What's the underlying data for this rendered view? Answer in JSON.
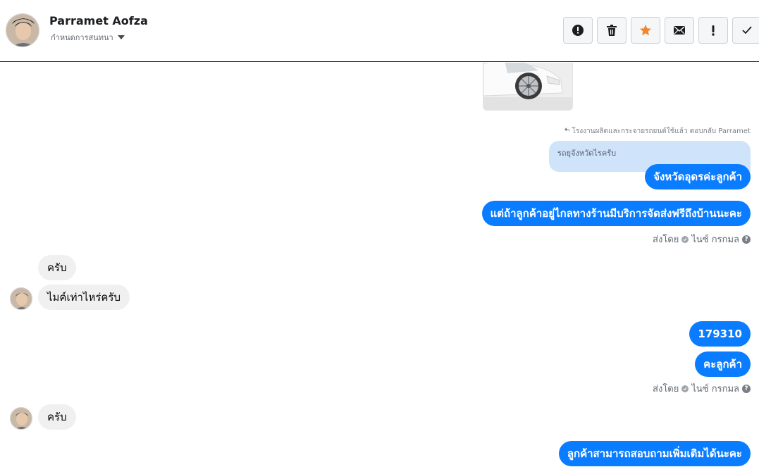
{
  "header": {
    "contact_name": "Parramet Aofza",
    "assign_label": "กำหนดการสนทนา"
  },
  "toolbar": {
    "buttons": [
      {
        "name": "alert-icon",
        "color": "#1c1e21"
      },
      {
        "name": "trash-icon",
        "color": "#1c1e21"
      },
      {
        "name": "star-icon",
        "color": "#f0862e"
      },
      {
        "name": "mail-icon",
        "color": "#1c1e21"
      },
      {
        "name": "exclamation-icon",
        "color": "#1c1e21"
      },
      {
        "name": "check-icon",
        "color": "#1c1e21"
      }
    ]
  },
  "thread": {
    "reply_note": "โรงงานผลิตและกระจายรถยนต์ใช้แล้ว ตอบกลับ Parramet",
    "quoted_text": "รถยุจังหวัดไรครับ",
    "messages": [
      {
        "direction": "out",
        "text": "จังหวัดอุดรค่ะลูกค้า"
      },
      {
        "direction": "out",
        "text": "แต่ถ้าลูกค้าอยู่ไกลทางร้านมีบริการจัดส่งฟรีถึงบ้านนะคะ"
      },
      {
        "direction": "in",
        "text": "ครับ"
      },
      {
        "direction": "in",
        "text": "ไมค์เท่าไหร่ครับ"
      },
      {
        "direction": "out",
        "text": "179310"
      },
      {
        "direction": "out",
        "text": "คะลูกค้า"
      },
      {
        "direction": "in",
        "text": "ครับ"
      },
      {
        "direction": "out",
        "text": "ลูกค้าสามารถสอบถามเพิ่มเติมได้นะคะ"
      }
    ],
    "sent_by_1": {
      "prefix": "ส่งโดย",
      "agent": "ไนซ์ กรกมล"
    },
    "sent_by_2": {
      "prefix": "ส่งโดย",
      "agent": "ไนซ์ กรกมล"
    }
  },
  "colors": {
    "outgoing_bubble": "#0a7cff",
    "incoming_bubble": "#f0f0f0",
    "quoted_bubble": "#cfe3fb",
    "star": "#f0862e"
  }
}
